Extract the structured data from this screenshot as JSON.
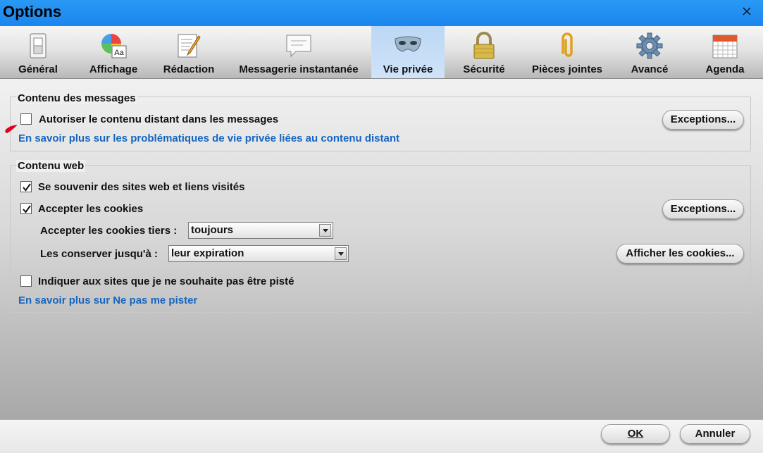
{
  "window": {
    "title": "Options",
    "close_icon": "close-icon"
  },
  "toolbar": {
    "tabs": [
      {
        "label": "Général",
        "icon": "switch-icon"
      },
      {
        "label": "Affichage",
        "icon": "palette-icon"
      },
      {
        "label": "Rédaction",
        "icon": "edit-document-icon"
      },
      {
        "label": "Messagerie instantanée",
        "icon": "chat-bubble-icon"
      },
      {
        "label": "Vie privée",
        "icon": "mask-icon"
      },
      {
        "label": "Sécurité",
        "icon": "padlock-icon"
      },
      {
        "label": "Pièces jointes",
        "icon": "paperclip-icon"
      },
      {
        "label": "Avancé",
        "icon": "gear-icon"
      },
      {
        "label": "Agenda",
        "icon": "calendar-icon"
      }
    ],
    "active_tab": "Vie privée",
    "active_color": "#c3dcf6"
  },
  "message_content": {
    "legend": "Contenu des messages",
    "remote_content": {
      "label": "Autoriser le contenu distant dans les messages",
      "checked": false
    },
    "exceptions_label": "Exceptions...",
    "learn_more": "En savoir plus sur les problématiques de vie privée liées au contenu distant"
  },
  "web_content": {
    "legend": "Contenu web",
    "remember_sites": {
      "label": "Se souvenir des sites web et liens visités",
      "checked": true
    },
    "accept_cookies": {
      "label": "Accepter les cookies",
      "checked": true
    },
    "exceptions_label": "Exceptions...",
    "third_party_label": "Accepter les cookies tiers :",
    "third_party_value": "toujours",
    "keep_until_label": "Les conserver jusqu'à :",
    "keep_until_value": "leur expiration",
    "show_cookies_label": "Afficher les cookies...",
    "do_not_track": {
      "label": "Indiquer aux sites que je ne souhaite pas être pisté",
      "checked": false
    },
    "learn_more": "En savoir plus sur Ne pas me pister"
  },
  "footer": {
    "ok_label": "OK",
    "cancel_label": "Annuler"
  },
  "colors": {
    "titlebar": "#1e8ff0",
    "link": "#1565c0",
    "marker": "#e0001b"
  }
}
